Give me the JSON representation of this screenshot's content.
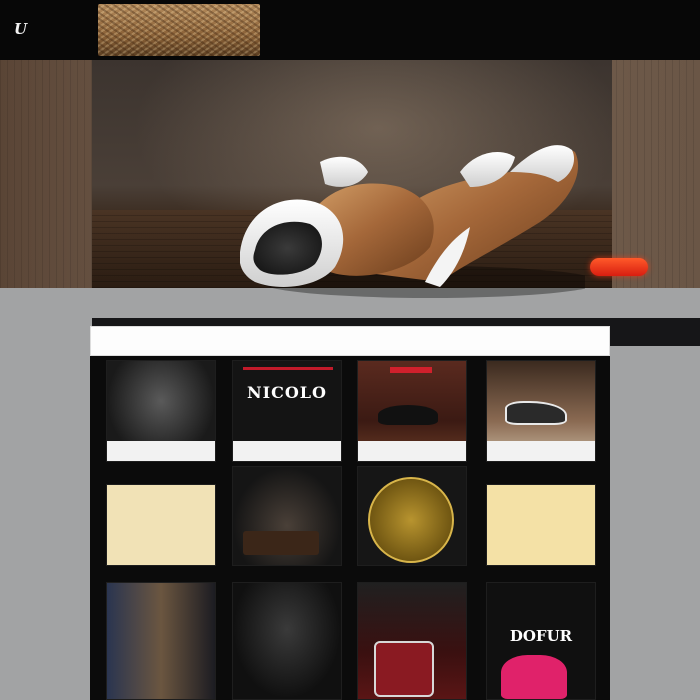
{
  "header": {
    "logo": "U"
  },
  "nav": {
    "items": [
      "",
      "",
      "",
      "",
      "",
      "",
      "",
      "",
      "",
      "",
      "",
      ""
    ]
  },
  "hero": {
    "tagline": "",
    "copy": "",
    "cta": "",
    "caption_left": "",
    "caption_right": ""
  },
  "gallery": {
    "bar_label": "",
    "tiles": [
      {
        "name": "product-tile-1",
        "label": ""
      },
      {
        "name": "product-tile-2",
        "label": "NICOLO"
      },
      {
        "name": "product-tile-3",
        "label": ""
      },
      {
        "name": "product-tile-4",
        "label": ""
      },
      {
        "name": "product-tile-5",
        "label": ""
      },
      {
        "name": "product-tile-6",
        "label": ""
      },
      {
        "name": "product-tile-7",
        "label": ""
      },
      {
        "name": "product-tile-8",
        "label": ""
      },
      {
        "name": "product-tile-9",
        "label": ""
      },
      {
        "name": "product-tile-10",
        "label": ""
      },
      {
        "name": "product-tile-11",
        "label": ""
      },
      {
        "name": "product-tile-12",
        "label": "DOFUR"
      }
    ]
  },
  "colors": {
    "header_bg": "#070707",
    "cta": "#e8301a",
    "page_bg": "#a2a3a4",
    "gallery_bg": "#0b0b0b"
  }
}
